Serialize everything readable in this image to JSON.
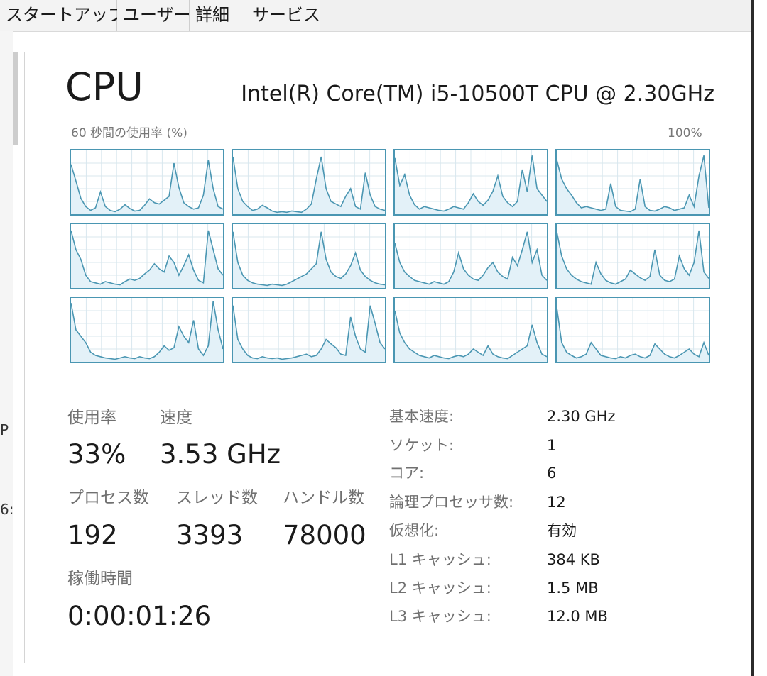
{
  "tabs": [
    "スタートアップ",
    "ユーザー",
    "詳細",
    "サービス"
  ],
  "side_fragments": [
    "P",
    "6:"
  ],
  "header": {
    "title": "CPU",
    "model": "Intel(R) Core(TM) i5-10500T CPU @ 2.30GHz"
  },
  "graph": {
    "label": "60 秒間の使用率 (%)",
    "max_label": "100%",
    "line_color": "#4a96b2",
    "fill_color": "#e3f1f8",
    "grid_color": "#d8e7ee",
    "cores": [
      [
        78,
        52,
        25,
        12,
        6,
        10,
        35,
        12,
        6,
        4,
        8,
        15,
        9,
        5,
        6,
        14,
        24,
        18,
        16,
        22,
        28,
        80,
        42,
        18,
        12,
        8,
        10,
        30,
        85,
        40,
        12,
        8
      ],
      [
        90,
        40,
        20,
        12,
        6,
        8,
        14,
        10,
        5,
        3,
        4,
        3,
        5,
        4,
        3,
        8,
        16,
        55,
        90,
        40,
        20,
        16,
        12,
        28,
        40,
        12,
        8,
        65,
        30,
        12,
        8,
        6
      ],
      [
        88,
        45,
        62,
        30,
        15,
        8,
        12,
        10,
        8,
        6,
        5,
        8,
        12,
        10,
        8,
        18,
        32,
        20,
        14,
        22,
        36,
        60,
        28,
        18,
        12,
        20,
        70,
        35,
        92,
        40,
        30,
        20
      ],
      [
        85,
        55,
        40,
        30,
        18,
        10,
        12,
        10,
        8,
        6,
        8,
        48,
        12,
        6,
        5,
        4,
        8,
        55,
        12,
        6,
        5,
        8,
        12,
        10,
        6,
        8,
        10,
        30,
        12,
        60,
        92,
        10
      ],
      [
        90,
        60,
        45,
        20,
        10,
        8,
        6,
        10,
        8,
        6,
        5,
        10,
        14,
        12,
        15,
        22,
        28,
        38,
        30,
        25,
        50,
        40,
        20,
        35,
        52,
        28,
        12,
        8,
        90,
        60,
        30,
        20
      ],
      [
        88,
        40,
        20,
        12,
        8,
        6,
        5,
        4,
        6,
        5,
        4,
        6,
        10,
        14,
        18,
        22,
        30,
        38,
        88,
        45,
        25,
        18,
        15,
        22,
        35,
        55,
        28,
        18,
        12,
        8,
        6,
        5
      ],
      [
        70,
        40,
        25,
        18,
        12,
        10,
        8,
        6,
        10,
        8,
        6,
        10,
        25,
        55,
        30,
        20,
        14,
        12,
        20,
        32,
        40,
        25,
        18,
        14,
        48,
        35,
        60,
        88,
        40,
        60,
        20,
        12
      ],
      [
        88,
        50,
        30,
        20,
        14,
        10,
        8,
        6,
        40,
        22,
        12,
        8,
        6,
        10,
        14,
        28,
        22,
        16,
        12,
        18,
        60,
        20,
        12,
        10,
        14,
        50,
        30,
        20,
        40,
        90,
        25,
        15
      ],
      [
        92,
        50,
        40,
        30,
        15,
        10,
        8,
        6,
        5,
        4,
        6,
        8,
        6,
        5,
        8,
        6,
        5,
        8,
        15,
        25,
        18,
        22,
        55,
        40,
        30,
        65,
        20,
        10,
        25,
        95,
        50,
        20
      ],
      [
        88,
        35,
        20,
        10,
        6,
        5,
        8,
        6,
        5,
        6,
        4,
        5,
        6,
        8,
        10,
        12,
        8,
        10,
        20,
        35,
        28,
        22,
        12,
        10,
        70,
        40,
        20,
        15,
        88,
        60,
        30,
        20
      ],
      [
        80,
        45,
        30,
        20,
        15,
        10,
        8,
        6,
        10,
        8,
        6,
        5,
        8,
        10,
        8,
        12,
        20,
        15,
        10,
        25,
        12,
        8,
        6,
        5,
        10,
        15,
        20,
        25,
        58,
        30,
        12,
        8
      ],
      [
        85,
        30,
        15,
        10,
        6,
        8,
        12,
        30,
        20,
        10,
        8,
        6,
        5,
        8,
        6,
        10,
        12,
        8,
        6,
        10,
        28,
        20,
        12,
        8,
        6,
        10,
        15,
        20,
        12,
        8,
        30,
        10
      ]
    ]
  },
  "stats": {
    "usage": {
      "label": "使用率",
      "value": "33%"
    },
    "speed": {
      "label": "速度",
      "value": "3.53 GHz"
    },
    "processes": {
      "label": "プロセス数",
      "value": "192"
    },
    "threads": {
      "label": "スレッド数",
      "value": "3393"
    },
    "handles": {
      "label": "ハンドル数",
      "value": "78000"
    },
    "uptime": {
      "label": "稼働時間",
      "value": "0:00:01:26"
    }
  },
  "specs": [
    {
      "label": "基本速度:",
      "value": "2.30 GHz"
    },
    {
      "label": "ソケット:",
      "value": "1"
    },
    {
      "label": "コア:",
      "value": "6"
    },
    {
      "label": "論理プロセッサ数:",
      "value": "12"
    },
    {
      "label": "仮想化:",
      "value": "有効"
    },
    {
      "label": "L1 キャッシュ:",
      "value": "384 KB"
    },
    {
      "label": "L2 キャッシュ:",
      "value": "1.5 MB"
    },
    {
      "label": "L3 キャッシュ:",
      "value": "12.0 MB"
    }
  ]
}
